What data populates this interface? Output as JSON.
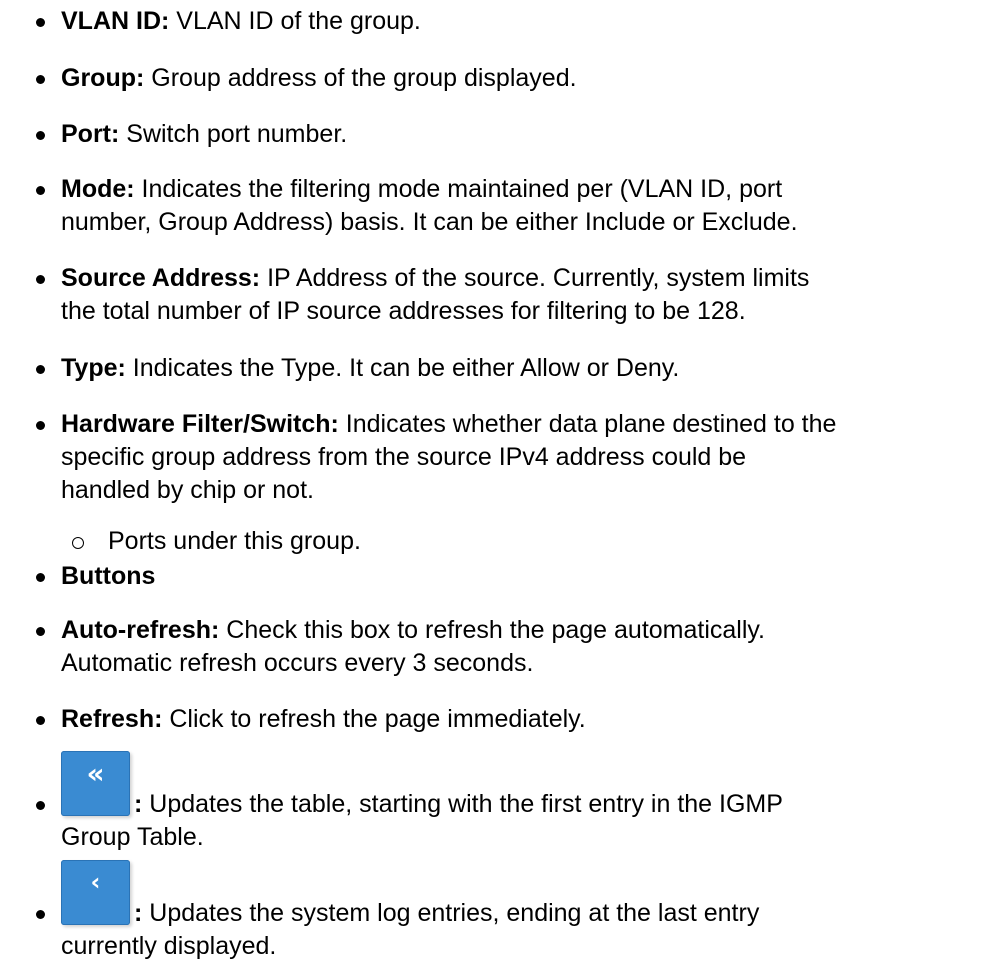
{
  "items": [
    {
      "term": "VLAN ID:",
      "desc": " VLAN ID of the group."
    },
    {
      "term": "Group:",
      "desc": " Group address of the group displayed."
    },
    {
      "term": "Port:",
      "desc": " Switch port number."
    },
    {
      "term": "Mode:",
      "desc": " Indicates the filtering mode maintained per (VLAN ID, port",
      "desc2": "number, Group Address) basis. It can be either Include or Exclude."
    },
    {
      "term": "Source Address:",
      "desc": " IP Address of the source. Currently, system limits",
      "desc2": "the total number of IP source addresses for filtering to be 128."
    },
    {
      "term": "Type:",
      "desc": " Indicates the Type. It can be either Allow or Deny."
    },
    {
      "term": "Hardware Filter/Switch:",
      "desc": " Indicates whether data plane destined to the",
      "desc2": "specific group address from the source IPv4 address could be",
      "desc3": "handled by chip or not."
    }
  ],
  "sub_item": "Ports under this group.",
  "buttons_heading": "Buttons",
  "auto_refresh": {
    "term": "Auto-refresh:",
    "desc": " Check this box to refresh the page automatically.",
    "desc2": "Automatic refresh occurs every 3 seconds."
  },
  "refresh": {
    "term": "Refresh:",
    "desc": " Click to refresh the page immediately."
  },
  "first_button": {
    "glyph": "«",
    "colon": ":",
    "desc": " Updates the table, starting with the first entry in the IGMP",
    "desc2": "Group Table.",
    "icon": "double-chevron-left-icon"
  },
  "prev_button": {
    "glyph": "‹",
    "colon": ":",
    "desc": " Updates the system log entries, ending at the last entry",
    "desc2": "currently displayed.",
    "icon": "chevron-left-icon"
  },
  "colors": {
    "button_blue": "#3a8bd2",
    "text": "#000000"
  }
}
